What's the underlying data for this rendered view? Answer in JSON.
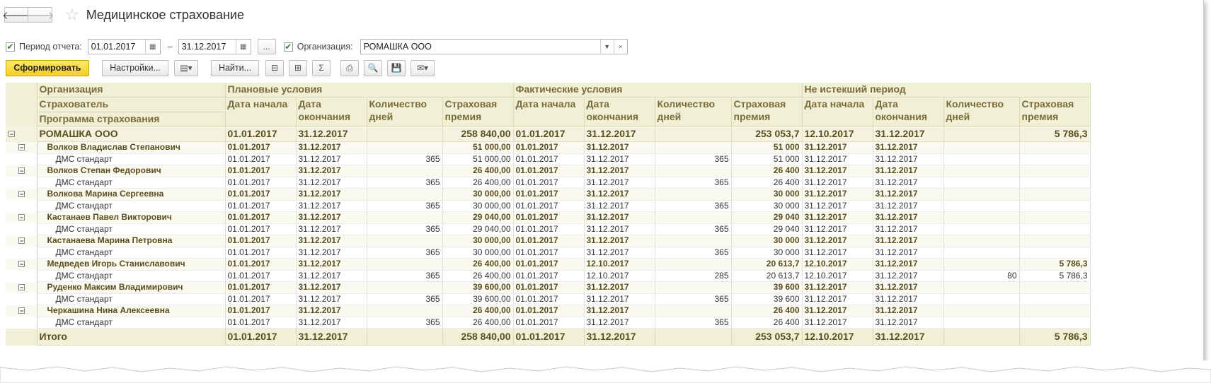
{
  "window": {
    "title": "Медицинское страхование",
    "back_icon": "arrow-left",
    "forward_icon": "arrow-right",
    "favorite_icon": "star"
  },
  "params": {
    "period_label": "Период отчета:",
    "period_from": "01.01.2017",
    "period_dash": "–",
    "period_to": "31.12.2017",
    "more_label": "...",
    "org_label": "Организация:",
    "org_value": "РОМАШКА ООО",
    "clear_label": "×"
  },
  "toolbar": {
    "generate_label": "Сформировать",
    "settings_label": "Настройки...",
    "find_label": "Найти...",
    "sum_label": "Σ"
  },
  "table": {
    "headers": {
      "org": "Организация",
      "insurer": "Страхователь",
      "program": "Программа страхования",
      "planned": "Плановые условия",
      "actual": "Фактические условия",
      "unexpired": "Не истекший период",
      "start": "Дата начала",
      "end": "Дата окончания",
      "days": "Количество дней",
      "premium": "Страховая премия"
    },
    "org_row": {
      "name": "РОМАШКА ООО",
      "cells": [
        "01.01.2017",
        "31.12.2017",
        "",
        "258 840,00",
        "01.01.2017",
        "31.12.2017",
        "",
        "253 053,7",
        "12.10.2017",
        "31.12.2017",
        "",
        "5 786,3"
      ]
    },
    "groups": [
      {
        "name": "Волков Владислав Степанович",
        "cells": [
          "01.01.2017",
          "31.12.2017",
          "",
          "51 000,00",
          "01.01.2017",
          "31.12.2017",
          "",
          "51 000",
          "31.12.2017",
          "31.12.2017",
          "",
          ""
        ],
        "detail": {
          "name": "ДМС стандарт",
          "cells": [
            "01.01.2017",
            "31.12.2017",
            "365",
            "51 000,00",
            "01.01.2017",
            "31.12.2017",
            "365",
            "51 000",
            "31.12.2017",
            "31.12.2017",
            "",
            ""
          ]
        }
      },
      {
        "name": "Волков Степан Федорович",
        "cells": [
          "01.01.2017",
          "31.12.2017",
          "",
          "26 400,00",
          "01.01.2017",
          "31.12.2017",
          "",
          "26 400",
          "31.12.2017",
          "31.12.2017",
          "",
          ""
        ],
        "detail": {
          "name": "ДМС стандарт",
          "cells": [
            "01.01.2017",
            "31.12.2017",
            "365",
            "26 400,00",
            "01.01.2017",
            "31.12.2017",
            "365",
            "26 400",
            "31.12.2017",
            "31.12.2017",
            "",
            ""
          ]
        }
      },
      {
        "name": "Волкова Марина Сергеевна",
        "cells": [
          "01.01.2017",
          "31.12.2017",
          "",
          "30 000,00",
          "01.01.2017",
          "31.12.2017",
          "",
          "30 000",
          "31.12.2017",
          "31.12.2017",
          "",
          ""
        ],
        "detail": {
          "name": "ДМС стандарт",
          "cells": [
            "01.01.2017",
            "31.12.2017",
            "365",
            "30 000,00",
            "01.01.2017",
            "31.12.2017",
            "365",
            "30 000",
            "31.12.2017",
            "31.12.2017",
            "",
            ""
          ]
        }
      },
      {
        "name": "Кастанаев Павел Викторович",
        "cells": [
          "01.01.2017",
          "31.12.2017",
          "",
          "29 040,00",
          "01.01.2017",
          "31.12.2017",
          "",
          "29 040",
          "31.12.2017",
          "31.12.2017",
          "",
          ""
        ],
        "detail": {
          "name": "ДМС стандарт",
          "cells": [
            "01.01.2017",
            "31.12.2017",
            "365",
            "29 040,00",
            "01.01.2017",
            "31.12.2017",
            "365",
            "29 040",
            "31.12.2017",
            "31.12.2017",
            "",
            ""
          ]
        }
      },
      {
        "name": "Кастанаева Марина Петровна",
        "cells": [
          "01.01.2017",
          "31.12.2017",
          "",
          "30 000,00",
          "01.01.2017",
          "31.12.2017",
          "",
          "30 000",
          "31.12.2017",
          "31.12.2017",
          "",
          ""
        ],
        "detail": {
          "name": "ДМС стандарт",
          "cells": [
            "01.01.2017",
            "31.12.2017",
            "365",
            "30 000,00",
            "01.01.2017",
            "31.12.2017",
            "365",
            "30 000",
            "31.12.2017",
            "31.12.2017",
            "",
            ""
          ]
        }
      },
      {
        "name": "Медведев Игорь Станиславович",
        "cells": [
          "01.01.2017",
          "31.12.2017",
          "",
          "26 400,00",
          "01.01.2017",
          "12.10.2017",
          "",
          "20 613,7",
          "12.10.2017",
          "31.12.2017",
          "",
          "5 786,3"
        ],
        "detail": {
          "name": "ДМС стандарт",
          "cells": [
            "01.01.2017",
            "31.12.2017",
            "365",
            "26 400,00",
            "01.01.2017",
            "12.10.2017",
            "285",
            "20 613,7",
            "12.10.2017",
            "31.12.2017",
            "80",
            "5 786,3"
          ]
        }
      },
      {
        "name": "Руденко Максим Владимирович",
        "cells": [
          "01.01.2017",
          "31.12.2017",
          "",
          "39 600,00",
          "01.01.2017",
          "31.12.2017",
          "",
          "39 600",
          "31.12.2017",
          "31.12.2017",
          "",
          ""
        ],
        "detail": {
          "name": "ДМС стандарт",
          "cells": [
            "01.01.2017",
            "31.12.2017",
            "365",
            "39 600,00",
            "01.01.2017",
            "31.12.2017",
            "365",
            "39 600",
            "31.12.2017",
            "31.12.2017",
            "",
            ""
          ]
        }
      },
      {
        "name": "Черкашина Нина Алексеевна",
        "cells": [
          "01.01.2017",
          "31.12.2017",
          "",
          "26 400,00",
          "01.01.2017",
          "31.12.2017",
          "",
          "26 400",
          "31.12.2017",
          "31.12.2017",
          "",
          ""
        ],
        "detail": {
          "name": "ДМС стандарт",
          "cells": [
            "01.01.2017",
            "31.12.2017",
            "365",
            "26 400,00",
            "01.01.2017",
            "31.12.2017",
            "365",
            "26 400",
            "31.12.2017",
            "31.12.2017",
            "",
            ""
          ]
        }
      }
    ],
    "total_row": {
      "name": "Итого",
      "cells": [
        "01.01.2017",
        "31.12.2017",
        "",
        "258 840,00",
        "01.01.2017",
        "31.12.2017",
        "",
        "253 053,7",
        "12.10.2017",
        "31.12.2017",
        "",
        "5 786,3"
      ]
    }
  },
  "colors": {
    "accent": "#f4cf1c",
    "header_bg": "#f1efd6",
    "header_text": "#7a6c3a"
  }
}
